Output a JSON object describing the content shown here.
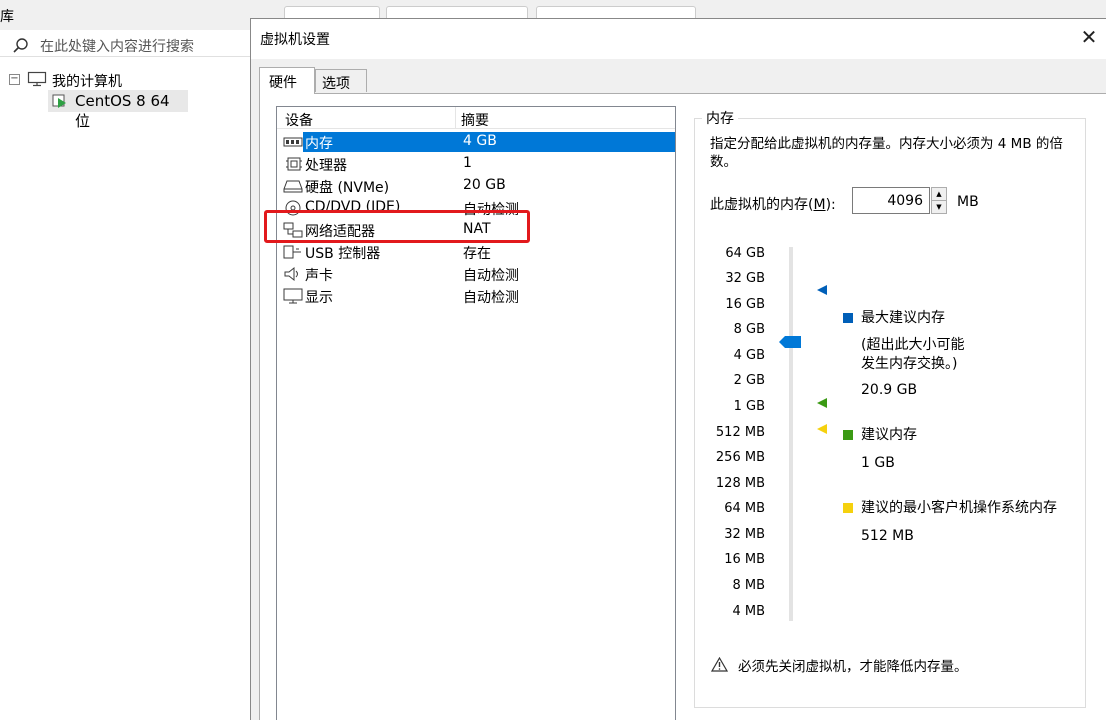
{
  "library": {
    "title": "库",
    "close_glyph": "×",
    "search_placeholder": "在此处键入内容进行搜索",
    "search_icon": "search-icon",
    "tree": {
      "collapse_glyph": "−",
      "computer_label": "我的计算机",
      "vm_label": "CentOS 8 64 位"
    }
  },
  "dialog": {
    "title": "虚拟机设置",
    "close_glyph": "✕",
    "tabs": [
      {
        "label": "硬件",
        "active": true
      },
      {
        "label": "选项",
        "active": false
      }
    ],
    "device_list": {
      "headers": {
        "device": "设备",
        "summary": "摘要"
      },
      "rows": [
        {
          "icon": "memory-icon",
          "name": "内存",
          "summary": "4 GB",
          "selected": true
        },
        {
          "icon": "cpu-icon",
          "name": "处理器",
          "summary": "1",
          "selected": false
        },
        {
          "icon": "disk-icon",
          "name": "硬盘 (NVMe)",
          "summary": "20 GB",
          "selected": false
        },
        {
          "icon": "cd-icon",
          "name": "CD/DVD (IDE)",
          "summary": "自动检测",
          "selected": false
        },
        {
          "icon": "network-icon",
          "name": "网络适配器",
          "summary": "NAT",
          "selected": false
        },
        {
          "icon": "usb-icon",
          "name": "USB 控制器",
          "summary": "存在",
          "selected": false
        },
        {
          "icon": "sound-icon",
          "name": "声卡",
          "summary": "自动检测",
          "selected": false
        },
        {
          "icon": "display-icon",
          "name": "显示",
          "summary": "自动检测",
          "selected": false
        }
      ],
      "highlighted_row": "网络适配器"
    },
    "memory": {
      "group_title": "内存",
      "description": "指定分配给此虚拟机的内存量。内存大小必须为 4 MB 的倍数。",
      "field_label": "此虚拟机的内存(M):",
      "field_label_plain": "此虚拟机的内存(",
      "field_label_mnemonic": "M",
      "field_label_end": "):",
      "value": "4096",
      "unit": "MB",
      "slider_ticks": [
        "64 GB",
        "32 GB",
        "16 GB",
        "8 GB",
        "4 GB",
        "2 GB",
        "1 GB",
        "512 MB",
        "256 MB",
        "128 MB",
        "64 MB",
        "32 MB",
        "16 MB",
        "8 MB",
        "4 MB"
      ],
      "slider_value": "4 GB",
      "legend": [
        {
          "color": "#005fb8",
          "label": "最大建议内存",
          "note_1": "(超出此大小可能",
          "note_2": "发生内存交换。)",
          "value": "20.9 GB"
        },
        {
          "color": "#3b9a14",
          "label": "建议内存",
          "value": "1 GB"
        },
        {
          "color": "#f5d10e",
          "label": "建议的最小客户机操作系统内存",
          "value": "512 MB"
        }
      ],
      "warning": "必须先关闭虚拟机，才能降低内存量。",
      "warning_icon": "warning-icon"
    },
    "highlight_color": "#e2191c",
    "selection_color": "#0078d7"
  }
}
